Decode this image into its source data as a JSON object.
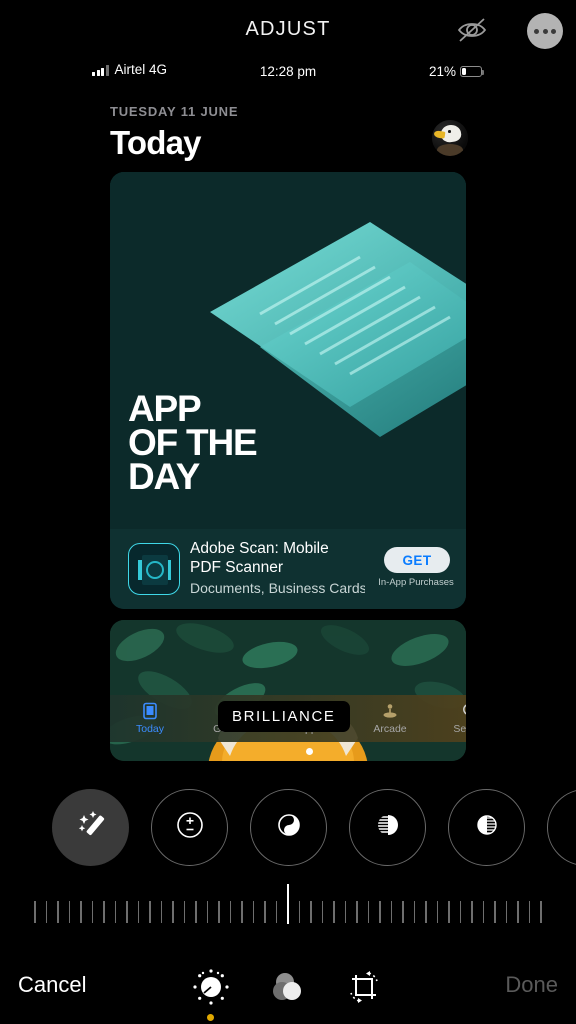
{
  "editor": {
    "title": "ADJUST",
    "hide_icon": "eye-slash-icon",
    "more_icon": "more-options-icon"
  },
  "photo": {
    "status_bar": {
      "carrier": "Airtel 4G",
      "time": "12:28 pm",
      "battery_percent": "21%",
      "signal_icon": "cellular-bars-icon",
      "battery_icon": "battery-icon"
    },
    "today": {
      "date": "TUESDAY 11 JUNE",
      "title": "Today",
      "avatar_icon": "eagle-avatar"
    },
    "featured_card": {
      "headline_line1": "APP",
      "headline_line2": "OF THE",
      "headline_line3": "DAY",
      "app_icon": "adobe-scan-icon",
      "app_name_line1": "Adobe Scan: Mobile",
      "app_name_line2": "PDF Scanner",
      "app_subtitle": "Documents, Business Cards,...",
      "get_label": "GET",
      "in_app_purchases": "In-App Purchases",
      "bg_color": "#0c2a2a",
      "accent_color": "#4fd6d6"
    },
    "second_card": {
      "art_name": "fox-illustration-artwork"
    },
    "tabbar": {
      "tooltip": "BRILLIANCE",
      "items": [
        {
          "label": "Today",
          "icon": "today-icon",
          "active": true
        },
        {
          "label": "Games",
          "icon": "rocket-icon",
          "active": false
        },
        {
          "label": "Apps",
          "icon": "apps-stack-icon",
          "active": false
        },
        {
          "label": "Arcade",
          "icon": "joystick-icon",
          "active": false
        },
        {
          "label": "Search",
          "icon": "search-icon",
          "active": false
        }
      ],
      "active_color": "#3b8cff"
    }
  },
  "tools": [
    {
      "name": "auto-enhance",
      "icon": "magic-wand-icon",
      "selected": true
    },
    {
      "name": "exposure",
      "icon": "plus-minus-circle-icon",
      "selected": false
    },
    {
      "name": "brilliance",
      "icon": "brilliance-icon",
      "selected": false
    },
    {
      "name": "highlights",
      "icon": "highlights-icon",
      "selected": false
    },
    {
      "name": "shadows",
      "icon": "shadows-icon",
      "selected": false
    },
    {
      "name": "contrast",
      "icon": "contrast-icon",
      "selected": false
    }
  ],
  "slider": {
    "value": "0",
    "tick_count": 45,
    "handle_position_percent": 50
  },
  "bottombar": {
    "cancel_label": "Cancel",
    "done_label": "Done",
    "modes": [
      {
        "name": "adjust",
        "icon": "adjust-dial-icon",
        "active": true
      },
      {
        "name": "filters",
        "icon": "filters-circles-icon",
        "active": false
      },
      {
        "name": "crop",
        "icon": "crop-rotate-icon",
        "active": false
      }
    ],
    "active_dot_color": "#e0a800"
  }
}
